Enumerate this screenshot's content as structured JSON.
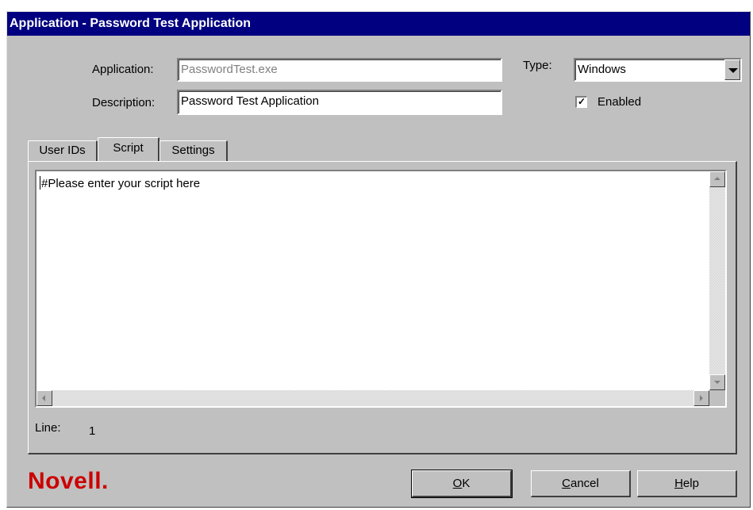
{
  "window": {
    "title": "Application - Password Test Application"
  },
  "form": {
    "application_label": "Application:",
    "application_value": "PasswordTest.exe",
    "description_label": "Description:",
    "description_value": "Password Test Application",
    "type_label": "Type:",
    "type_value": "Windows",
    "enabled_label": "Enabled",
    "enabled_checked": true
  },
  "tabs": [
    {
      "label": "User IDs",
      "active": false
    },
    {
      "label": "Script",
      "active": true
    },
    {
      "label": "Settings",
      "active": false
    }
  ],
  "script": {
    "content": "#Please enter your script here",
    "line_label": "Line:",
    "line_value": "1"
  },
  "buttons": {
    "ok": {
      "mnemonic": "O",
      "rest": "K"
    },
    "cancel": {
      "mnemonic": "C",
      "rest": "ancel"
    },
    "help": {
      "mnemonic": "H",
      "rest": "elp"
    }
  },
  "brand": {
    "name": "Novell.",
    "color": "#cc0000"
  },
  "icons": {
    "dropdown": "chevron-down-icon",
    "check": "check-icon"
  },
  "colors": {
    "titlebar": "#000080",
    "face": "#c0c0c0"
  }
}
